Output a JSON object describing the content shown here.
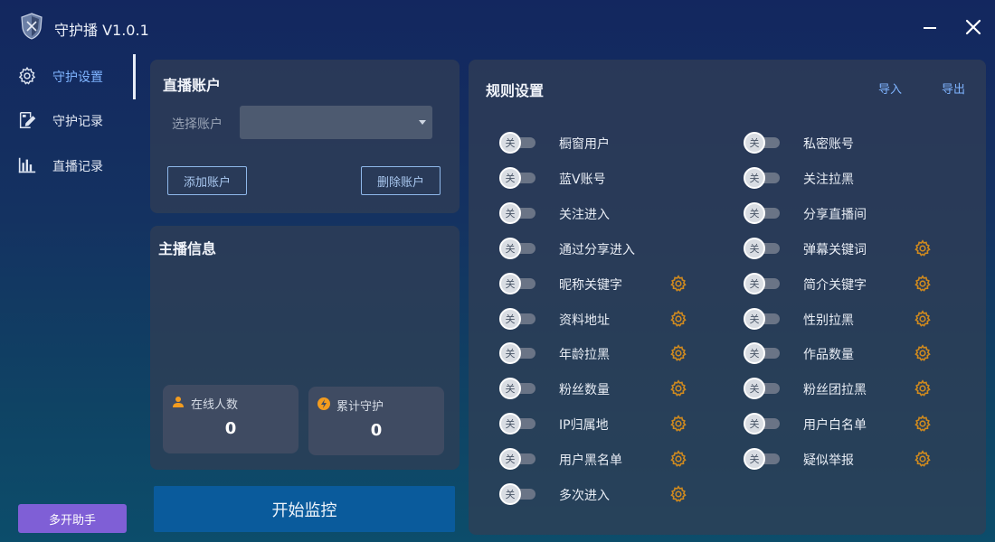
{
  "window": {
    "title": "守护播 V1.0.1",
    "icons": {
      "logo": "shield-logo-icon",
      "minimize": "minimize-icon",
      "close": "close-icon"
    }
  },
  "sidebar": {
    "items": [
      {
        "label": "守护设置",
        "icon": "gear-icon",
        "active": true
      },
      {
        "label": "守护记录",
        "icon": "edit-note-icon",
        "active": false
      },
      {
        "label": "直播记录",
        "icon": "bar-chart-icon",
        "active": false
      }
    ],
    "multi_assistant_label": "多开助手"
  },
  "account": {
    "title": "直播账户",
    "select_label": "选择账户",
    "select_value": "",
    "add_label": "添加账户",
    "delete_label": "删除账户"
  },
  "anchor": {
    "title": "主播信息",
    "online_label": "在线人数",
    "online_value": "0",
    "guard_label": "累计守护",
    "guard_value": "0"
  },
  "start_label": "开始监控",
  "rules": {
    "title": "规则设置",
    "import_label": "导入",
    "export_label": "导出",
    "toggle_off_text": "关",
    "colors": {
      "accent": "#7fb4ff",
      "gear": "#d08a1e",
      "start_button": "#0a5b9c",
      "multi_button": "#7f5fd6"
    },
    "left": [
      {
        "label": "橱窗用户",
        "gear": false
      },
      {
        "label": "蓝V账号",
        "gear": false
      },
      {
        "label": "关注进入",
        "gear": false
      },
      {
        "label": "通过分享进入",
        "gear": false
      },
      {
        "label": "昵称关键字",
        "gear": true
      },
      {
        "label": "资料地址",
        "gear": true
      },
      {
        "label": "年龄拉黑",
        "gear": true
      },
      {
        "label": "粉丝数量",
        "gear": true
      },
      {
        "label": "IP归属地",
        "gear": true
      },
      {
        "label": "用户黑名单",
        "gear": true
      },
      {
        "label": "多次进入",
        "gear": true
      }
    ],
    "right": [
      {
        "label": "私密账号",
        "gear": false
      },
      {
        "label": "关注拉黑",
        "gear": false
      },
      {
        "label": "分享直播间",
        "gear": false
      },
      {
        "label": "弹幕关键词",
        "gear": true
      },
      {
        "label": "简介关键字",
        "gear": true
      },
      {
        "label": "性别拉黑",
        "gear": true
      },
      {
        "label": "作品数量",
        "gear": true
      },
      {
        "label": "粉丝团拉黑",
        "gear": true
      },
      {
        "label": "用户白名单",
        "gear": true
      },
      {
        "label": "疑似举报",
        "gear": true
      }
    ]
  }
}
